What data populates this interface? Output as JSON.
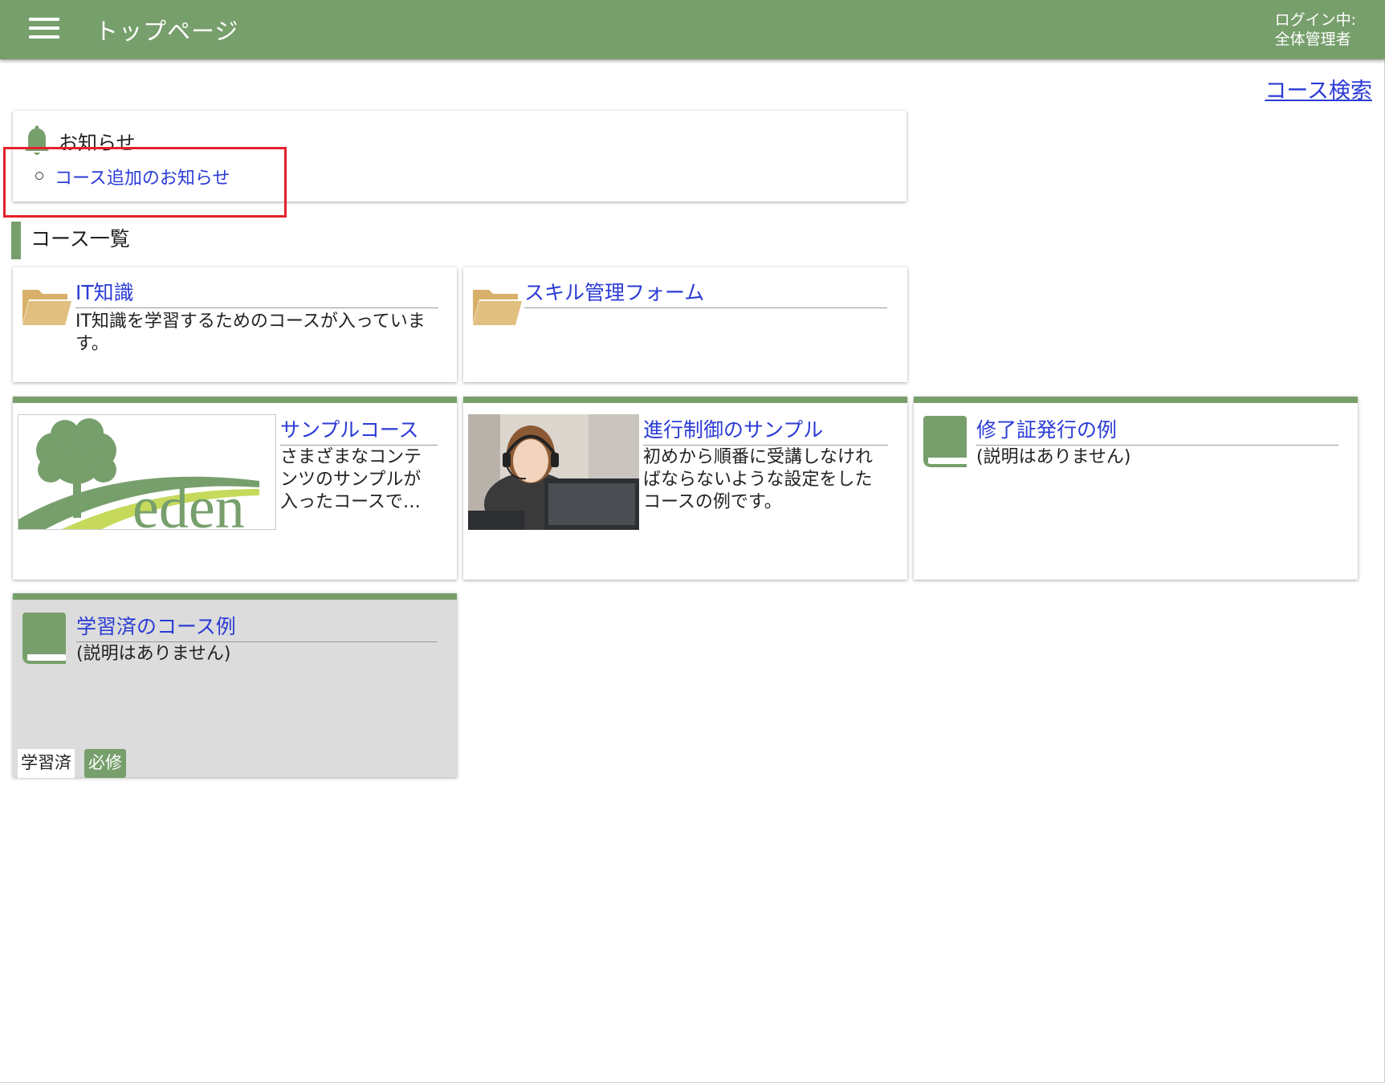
{
  "header": {
    "title": "トップページ",
    "login_status": "ログイン中:",
    "user_name": "全体管理者",
    "menu_icon": "hamburger-menu-icon",
    "bg_color": "#779f6c"
  },
  "course_search_link": "コース検索",
  "notice": {
    "title": "お知らせ",
    "icon": "bell-icon",
    "items": [
      "コース追加のお知らせ"
    ]
  },
  "course_list": {
    "heading": "コース一覧",
    "folders": [
      {
        "title": "IT知識",
        "description": "IT知識を学習するためのコースが入っています。",
        "icon": "folder-icon"
      },
      {
        "title": "スキル管理フォーム",
        "description": "",
        "icon": "folder-icon"
      }
    ],
    "courses": [
      {
        "title": "サンプルコース",
        "description": "さまざまなコンテンツのサンプルが入ったコースで…",
        "thumbnail": "eden-logo",
        "logo_text": "eden"
      },
      {
        "title": "進行制御のサンプル",
        "description": "初めから順番に受講しなければならないような設定をしたコースの例です。",
        "thumbnail": "headset-person-photo"
      },
      {
        "title": "修了証発行の例",
        "description": "(説明はありません)",
        "icon": "book-icon"
      },
      {
        "title": "学習済のコース例",
        "description": "(説明はありません)",
        "icon": "book-icon",
        "tags": [
          "学習済",
          "必修"
        ]
      }
    ]
  },
  "colors": {
    "accent": "#779f6c",
    "link": "#2b3bd6",
    "folder": "#e0bf7f",
    "highlight_box": "#e5202b",
    "completed_card_bg": "#dcdcdc"
  }
}
